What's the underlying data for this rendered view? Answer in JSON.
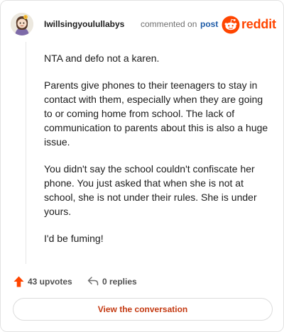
{
  "header": {
    "username": "Iwillsingyoulullabys",
    "commented_text": "commented on",
    "post_link": "post",
    "logo_text": "reddit",
    "avatar_icon": "snoo-avatar-icon",
    "logo_icon": "reddit-snoo-icon"
  },
  "comment": {
    "paragraphs": [
      "NTA and defo not a karen.",
      "Parents give phones to their teenagers to stay in contact with them, especially when they are going to or coming home from school. The lack of communication to parents about this is also a huge issue.",
      "You didn't say the school couldn't confiscate her phone. You just asked that when she is not at school, she is not under their rules. She is under yours.",
      "I'd be fuming!"
    ]
  },
  "actions": {
    "upvotes": "43 upvotes",
    "replies": "0 replies",
    "upvote_icon": "upvote-arrow-icon",
    "reply_icon": "reply-arrow-icon"
  },
  "button": {
    "view_conversation": "View the conversation"
  },
  "colors": {
    "brand": "#ff4500",
    "link": "#1f5ca8",
    "button_text": "#c43a12",
    "meta_text": "#707070"
  }
}
